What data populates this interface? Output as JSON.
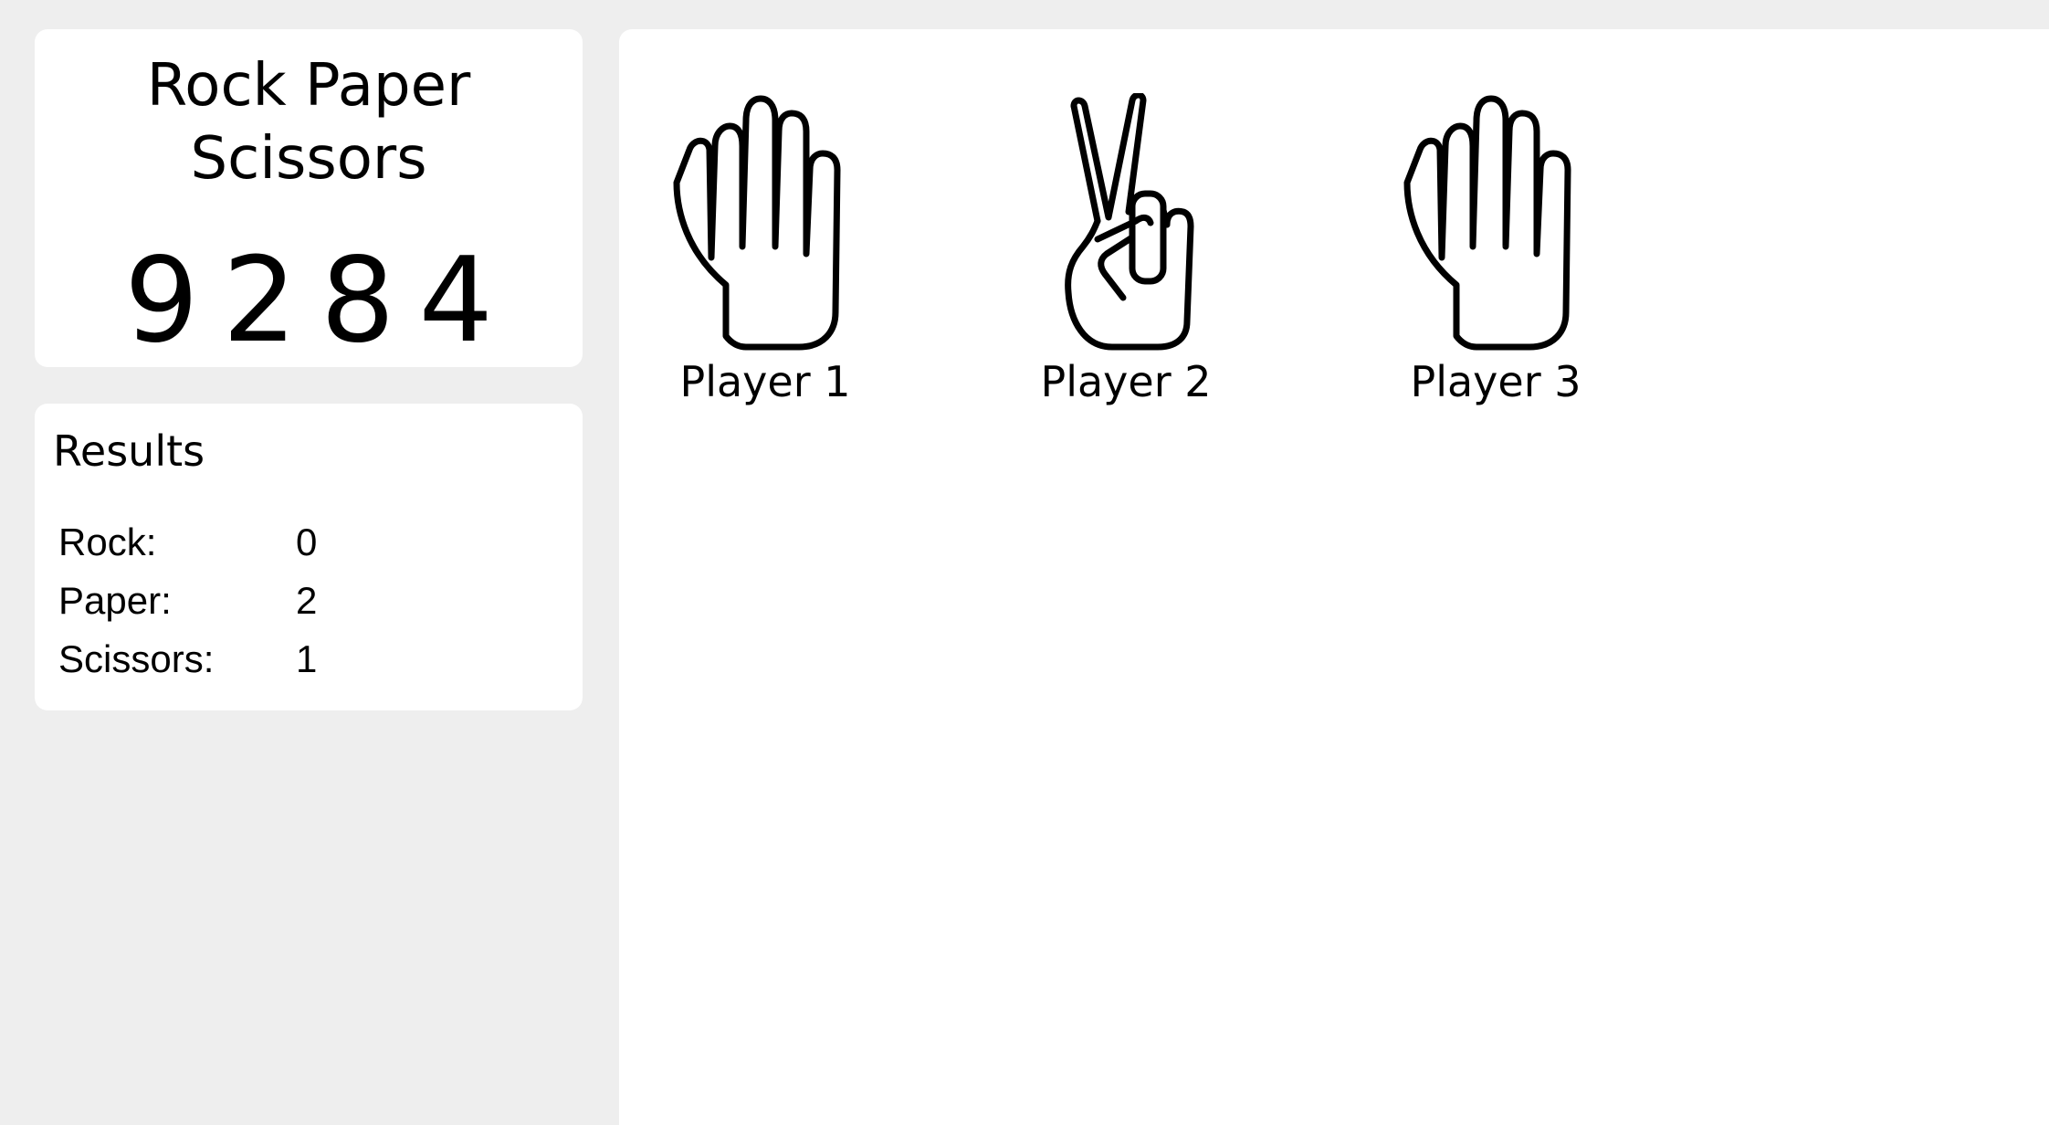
{
  "app": {
    "title_line1": "Rock Paper",
    "title_line2": "Scissors",
    "counter": "9284"
  },
  "results": {
    "heading": "Results",
    "rows": [
      {
        "label": "Rock:",
        "value": "0"
      },
      {
        "label": "Paper:",
        "value": "2"
      },
      {
        "label": "Scissors:",
        "value": "1"
      }
    ]
  },
  "players": [
    {
      "name": "Player 1",
      "hand": "paper",
      "icon": "open-hand-icon"
    },
    {
      "name": "Player 2",
      "hand": "scissors",
      "icon": "peace-hand-icon"
    },
    {
      "name": "Player 3",
      "hand": "paper",
      "icon": "open-hand-icon"
    }
  ]
}
